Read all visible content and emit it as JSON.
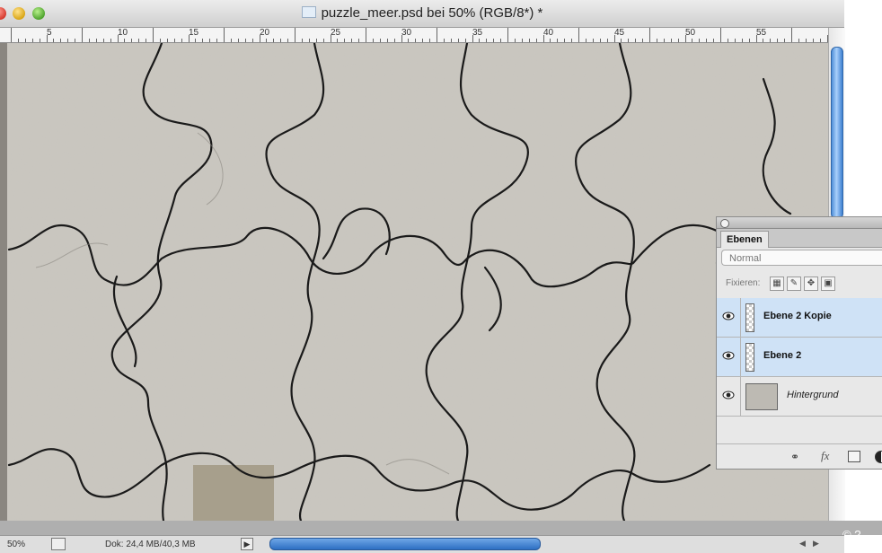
{
  "window": {
    "title": "puzzle_meer.psd bei 50% (RGB/8*) *"
  },
  "ruler": {
    "labels": [
      "5",
      "10",
      "15",
      "20",
      "25",
      "30",
      "35",
      "40",
      "45",
      "50",
      "55"
    ]
  },
  "status": {
    "zoom": "50%",
    "doc_size": "Dok: 24,4 MB/40,3 MB"
  },
  "copyright": "© ?",
  "layers_panel": {
    "tab": "Ebenen",
    "blend_mode": "Normal",
    "lock_label": "Fixieren:",
    "layers": [
      {
        "name": "Ebene 2 Kopie",
        "selected": true,
        "visible": true
      },
      {
        "name": "Ebene 2",
        "selected": true,
        "visible": true
      },
      {
        "name": "Hintergrund",
        "selected": false,
        "visible": true
      }
    ],
    "footer_icons": [
      "link-icon",
      "fx-icon",
      "mask-icon",
      "adjustment-icon"
    ]
  },
  "colors": {
    "canvas": "#c9c6bf",
    "selection": "#cfe2f6",
    "scroll_thumb": "#5b9be0"
  }
}
